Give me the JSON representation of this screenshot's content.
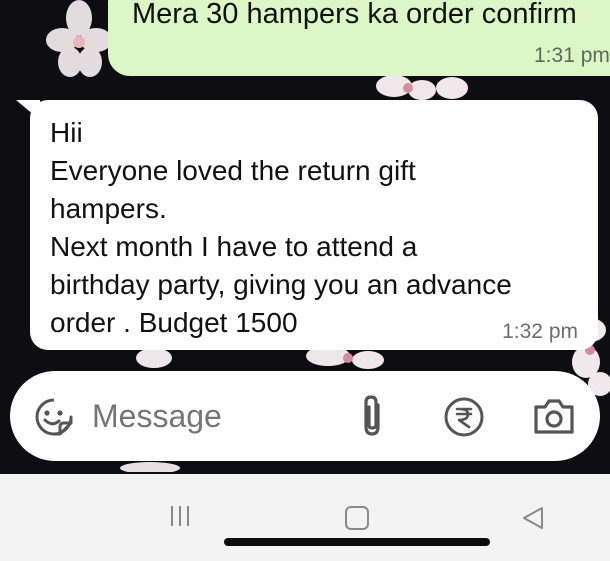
{
  "chat": {
    "outgoing": {
      "text": "Mera 30 hampers ka order confirm",
      "time": "1:31 pm"
    },
    "incoming": {
      "lines": [
        "Hii",
        "Everyone loved the return gift",
        "hampers.",
        "Next month I have to attend a",
        "birthday party, giving you an advance",
        "order . Budget 1500"
      ],
      "time": "1:32 pm"
    }
  },
  "composer": {
    "placeholder": "Message",
    "icons": [
      "emoji-icon",
      "attach-icon",
      "rupee-icon",
      "camera-icon"
    ]
  },
  "navbar": {
    "icons": [
      "recent-apps-icon",
      "home-icon",
      "back-icon"
    ]
  },
  "colors": {
    "outgoing_bubble": "#dcf7c5",
    "incoming_bubble": "#ffffff",
    "chat_background": "#0e0d10",
    "icon_gray": "#555555"
  }
}
